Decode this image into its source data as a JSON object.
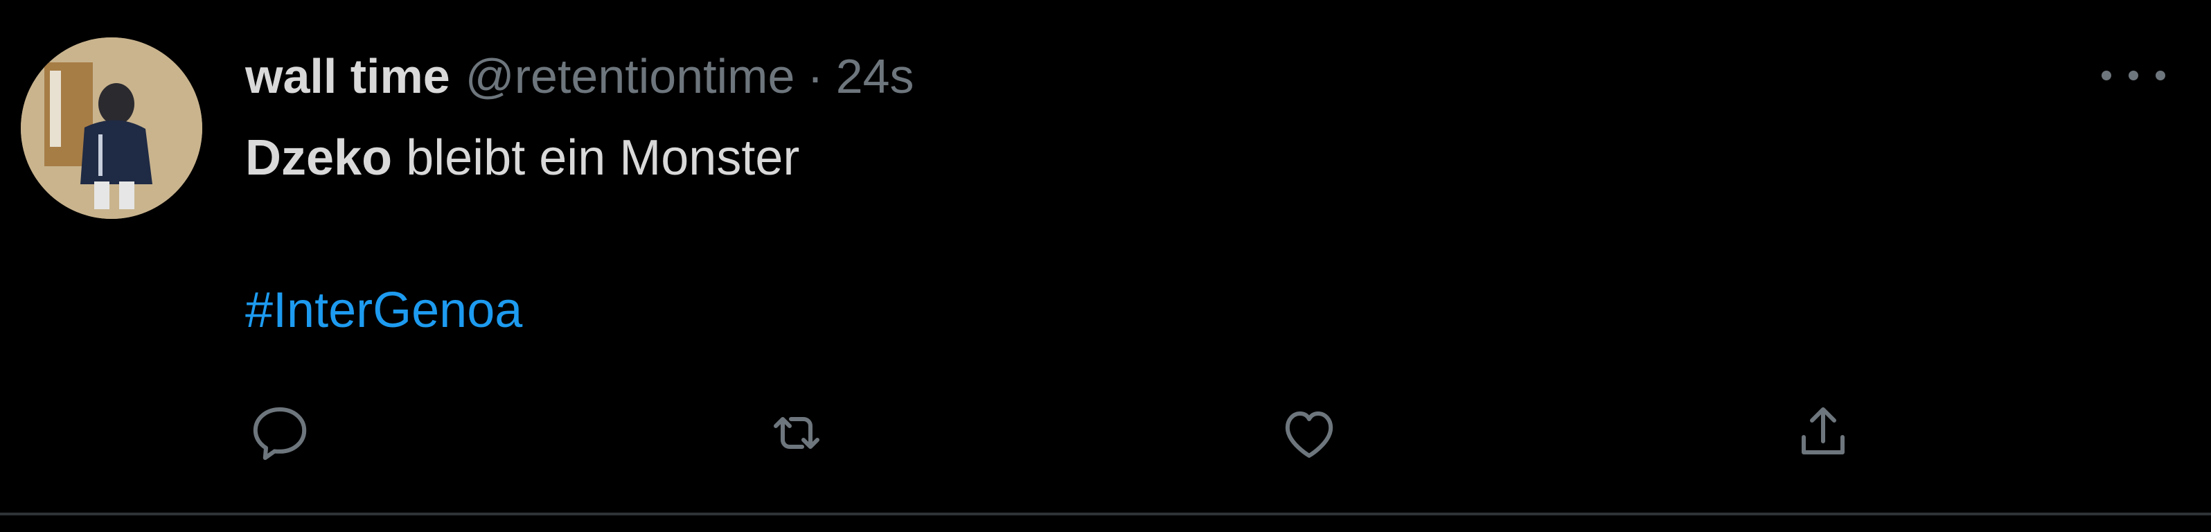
{
  "tweet": {
    "display_name": "wall time",
    "handle": "@retentiontime",
    "separator": "·",
    "time": "24s",
    "text_bold": "Dzeko",
    "text_rest": " bleibt ein Monster",
    "hashtag": "#InterGenoa"
  },
  "icons": {
    "avatar": "profile-photo",
    "more": "more-horizontal-icon",
    "reply": "reply-icon",
    "retweet": "retweet-icon",
    "like": "like-icon",
    "share": "share-icon"
  },
  "colors": {
    "background": "#000000",
    "primary_text": "#d9d9d9",
    "secondary_text": "#6e767d",
    "link": "#1d9bf0",
    "divider": "#2f3336"
  }
}
